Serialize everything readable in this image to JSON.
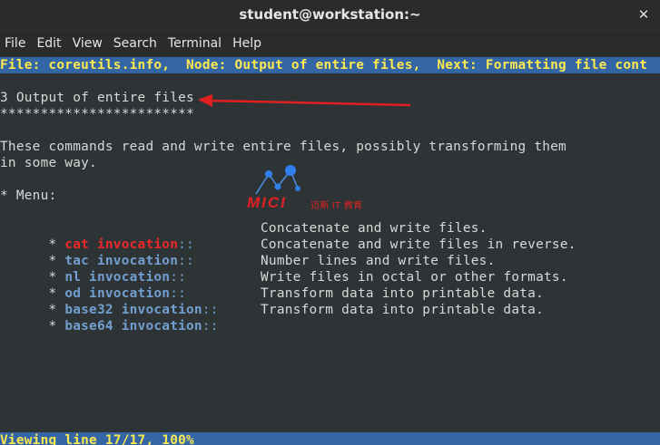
{
  "window": {
    "title": "student@workstation:~",
    "close_glyph": "✕"
  },
  "menubar": {
    "items": [
      "File",
      "Edit",
      "View",
      "Search",
      "Terminal",
      "Help"
    ]
  },
  "terminal": {
    "header": "File: coreutils.info,  Node: Output of entire files,  Next: Formatting file cont",
    "section_title": "3 Output of entire files",
    "section_underline": "************************",
    "description_line1": "These commands read and write entire files, possibly transforming them",
    "description_line2": "in some way.",
    "menu_label": "* Menu:",
    "entries": [
      {
        "bullet": "* ",
        "cmd": "cat invocation",
        "sep": "::",
        "desc": "Concatenate and write files."
      },
      {
        "bullet": "* ",
        "cmd": "tac invocation",
        "sep": "::",
        "desc": "Concatenate and write files in reverse."
      },
      {
        "bullet": "* ",
        "cmd": "nl invocation",
        "sep": "::",
        "desc": "Number lines and write files."
      },
      {
        "bullet": "* ",
        "cmd": "od invocation",
        "sep": "::",
        "desc": "Write files in octal or other formats."
      },
      {
        "bullet": "* ",
        "cmd": "base32 invocation",
        "sep": "::",
        "desc": "Transform data into printable data."
      },
      {
        "bullet": "* ",
        "cmd": "base64 invocation",
        "sep": "::",
        "desc": "Transform data into printable data."
      }
    ],
    "status": "Viewing line 17/17, 100%"
  },
  "watermark": {
    "brand": "MICI",
    "sub": "迈斯 IT 教育"
  },
  "colors": {
    "status_bar_bg": "#3465a4",
    "status_bar_fg": "#fce94f",
    "link": "#729fcf",
    "selected_link": "#ef2929",
    "annotation_arrow": "#e02020"
  }
}
